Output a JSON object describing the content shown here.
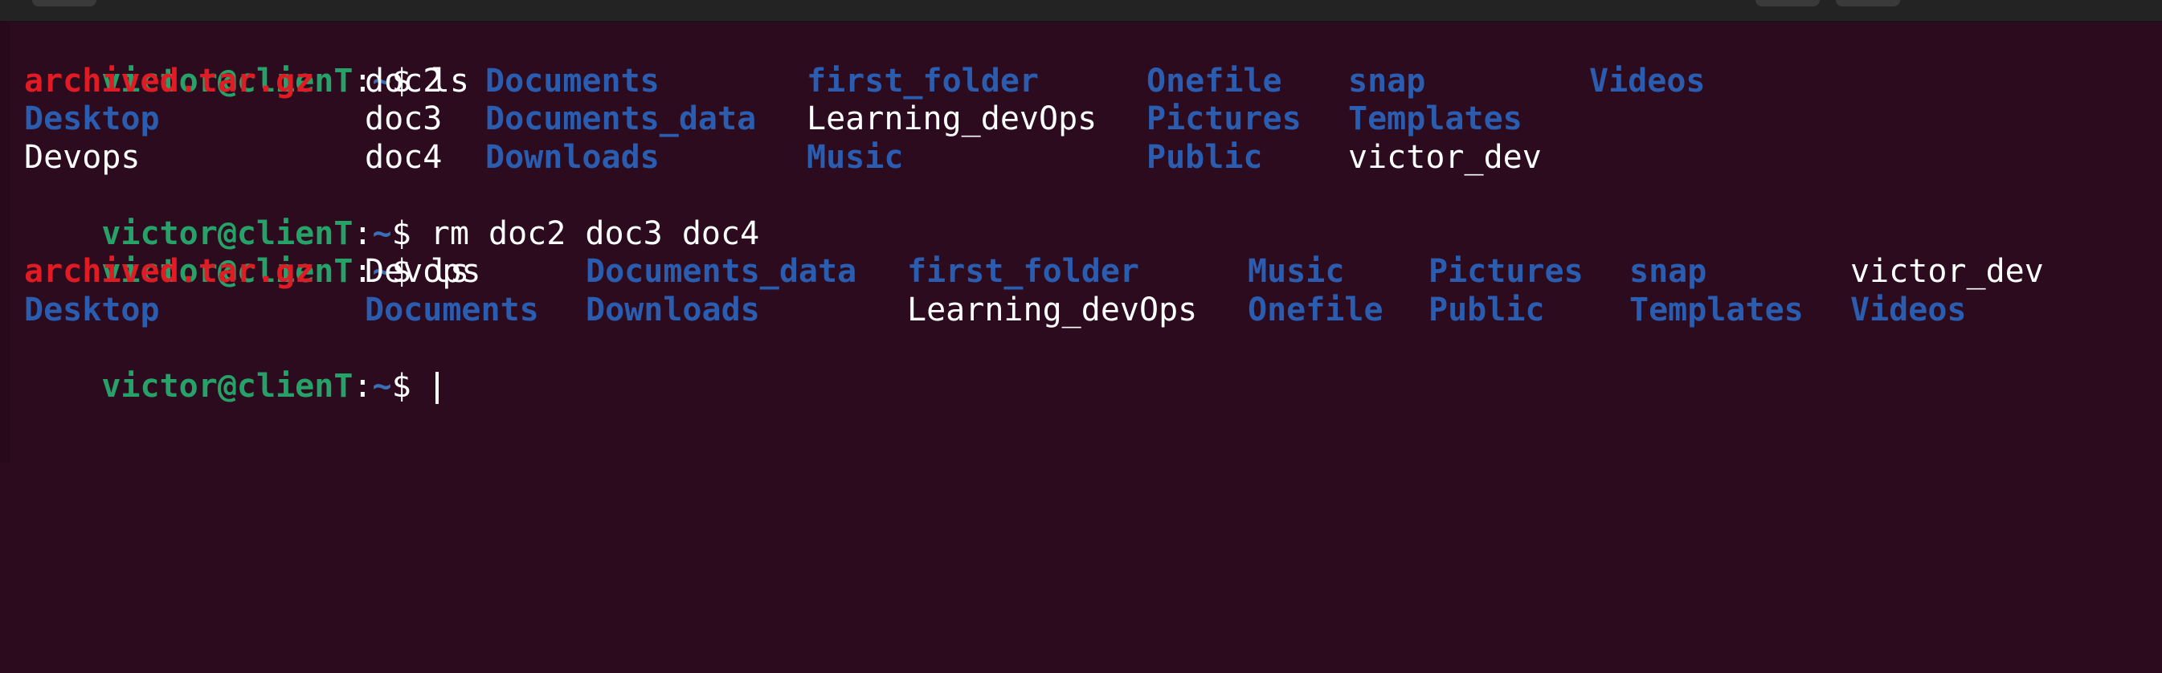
{
  "colors": {
    "background": "#2c0b1f",
    "prompt_user": "#26a269",
    "prompt_path": "#3a6fb8",
    "directory": "#2a5db0",
    "archive": "#e01b24",
    "text": "#ffffff"
  },
  "prompt": {
    "user_host": "victor@clienT",
    "separator": ":",
    "path": "~",
    "symbol": "$ "
  },
  "commands": {
    "c1": "ls",
    "c2": "rm doc2 doc3 doc4",
    "c3": "ls"
  },
  "listing1": {
    "archived": "archived.tar.gz",
    "desktop": "Desktop",
    "devops": "Devops",
    "doc2": "doc2",
    "doc3": "doc3",
    "doc4": "doc4",
    "documents": "Documents",
    "documents_data": "Documents_data",
    "downloads": "Downloads",
    "first_folder": "first_folder",
    "learning_devops": "Learning_devOps",
    "music": "Music",
    "onefile": "Onefile",
    "pictures": "Pictures",
    "public": "Public",
    "snap": "snap",
    "templates": "Templates",
    "victor_dev": "victor_dev",
    "videos": "Videos"
  },
  "listing2": {
    "archived": "archived.tar.gz",
    "desktop": "Desktop",
    "devops": "Devops",
    "documents": "Documents",
    "documents_data": "Documents_data",
    "downloads": "Downloads",
    "first_folder": "first_folder",
    "learning_devops": "Learning_devOps",
    "music": "Music",
    "onefile": "Onefile",
    "pictures": "Pictures",
    "public": "Public",
    "snap": "snap",
    "templates": "Templates",
    "victor_dev": "victor_dev",
    "videos": "Videos"
  }
}
